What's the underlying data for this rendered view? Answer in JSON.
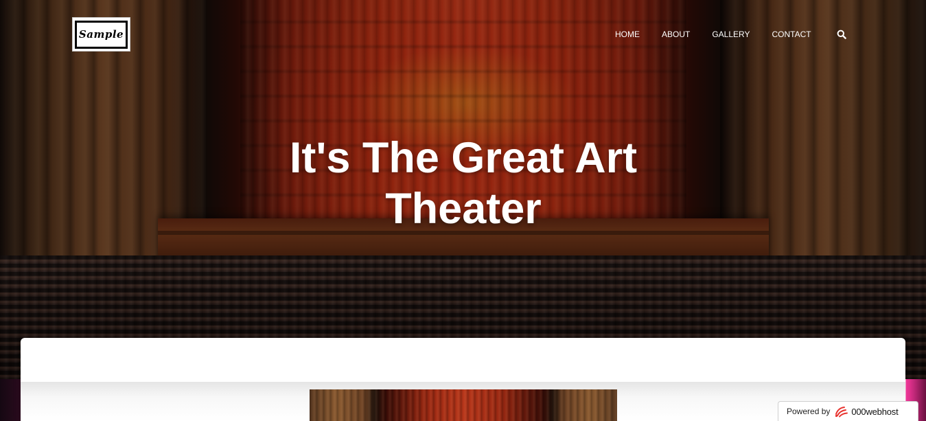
{
  "header": {
    "logo_text": "Sample",
    "nav": [
      {
        "label": "HOME"
      },
      {
        "label": "ABOUT"
      },
      {
        "label": "GALLERY"
      },
      {
        "label": "CONTACT"
      }
    ],
    "search_icon": "search-icon"
  },
  "hero": {
    "title": "It's The Great Art Theater"
  },
  "badge": {
    "powered_label": "Powered by",
    "host_name": "000webhost",
    "host_icon": "000webhost-logo-icon"
  },
  "colors": {
    "hero_curtain": "#b8361a",
    "nav_text": "#ffffff",
    "card_bg": "#ffffff",
    "badge_accent": "#e8332f"
  }
}
